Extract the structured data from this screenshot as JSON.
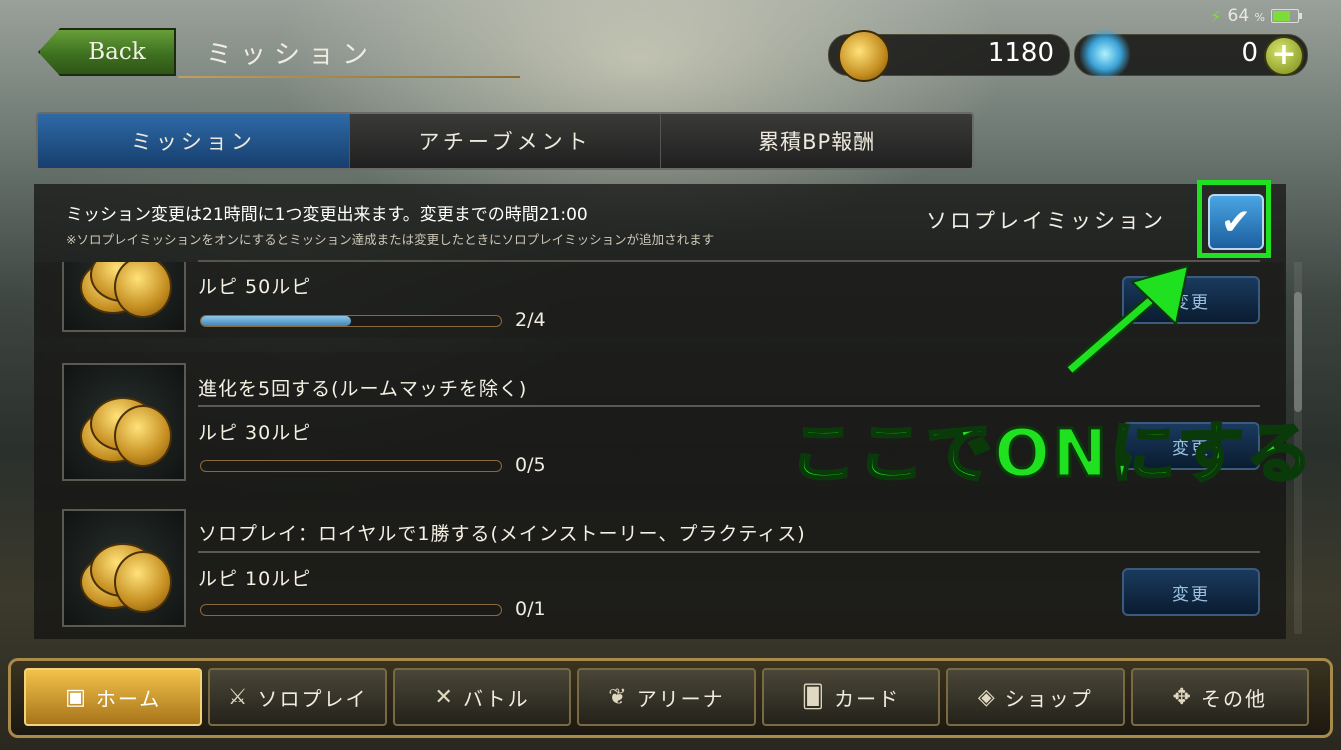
{
  "status": {
    "battery": "64",
    "pct_sign": "%"
  },
  "header": {
    "back_label": "Back",
    "title": "ミッション"
  },
  "currency": {
    "rupi": "1180",
    "crystal": "0",
    "plus": "+"
  },
  "tabs": [
    {
      "label": "ミッション",
      "active": true
    },
    {
      "label": "アチーブメント",
      "active": false
    },
    {
      "label": "累積BP報酬",
      "active": false
    }
  ],
  "notice": {
    "main": "ミッション変更は21時間に1つ変更出来ます。変更までの時間21:00",
    "sub": "※ソロプレイミッションをオンにするとミッション達成または変更したときにソロプレイミッションが追加されます"
  },
  "solo": {
    "label": "ソロプレイミッション",
    "checked": true
  },
  "missions": [
    {
      "title": "",
      "reward": "ルピ 50ルピ",
      "progress": "2/4",
      "progress_fraction": 0.5,
      "change_label": "変更"
    },
    {
      "title": "進化を5回する(ルームマッチを除く)",
      "reward": "ルピ 30ルピ",
      "progress": "0/5",
      "progress_fraction": 0,
      "change_label": "変更"
    },
    {
      "title": "ソロプレイ：ロイヤルで1勝する(メインストーリー、プラクティス)",
      "reward": "ルピ 10ルピ",
      "progress": "0/1",
      "progress_fraction": 0,
      "change_label": "変更"
    }
  ],
  "annotation": {
    "text": "ここでONにする",
    "color": "#1fe11f"
  },
  "nav": [
    {
      "label": "ホーム",
      "icon": "home-icon",
      "active": true
    },
    {
      "label": "ソロプレイ",
      "icon": "sword-icon",
      "active": false
    },
    {
      "label": "バトル",
      "icon": "crossed-swords-icon",
      "active": false
    },
    {
      "label": "アリーナ",
      "icon": "laurel-icon",
      "active": false
    },
    {
      "label": "カード",
      "icon": "cards-icon",
      "active": false
    },
    {
      "label": "ショップ",
      "icon": "gem-icon",
      "active": false
    },
    {
      "label": "その他",
      "icon": "other-icon",
      "active": false
    }
  ]
}
